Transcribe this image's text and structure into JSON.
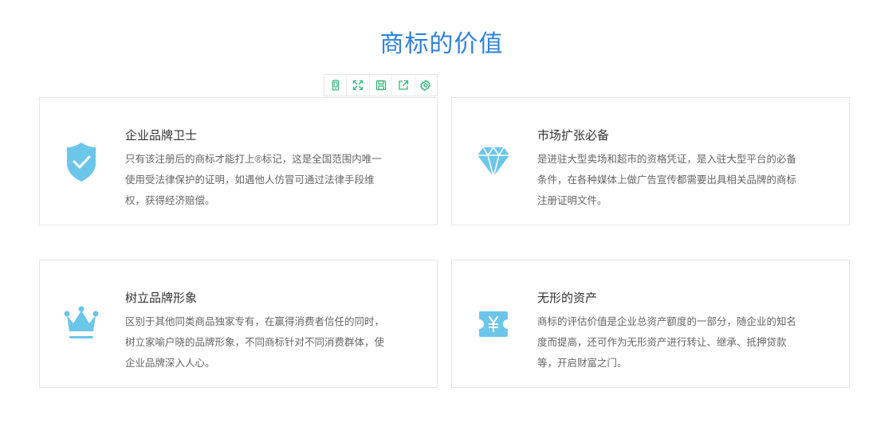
{
  "section": {
    "title": "商标的价值"
  },
  "colors": {
    "title": "#2f82dc",
    "icon": "#6cc6ea",
    "toolbar_icon": "#35b87c"
  },
  "toolbar": [
    {
      "icon": "mobile-icon"
    },
    {
      "icon": "expand-icon"
    },
    {
      "icon": "save-icon"
    },
    {
      "icon": "share-icon"
    },
    {
      "icon": "gear-icon"
    }
  ],
  "cards": [
    {
      "icon": "shield-check-icon",
      "title": "企业品牌卫士",
      "description": "只有该注册后的商标才能打上®标记，这是全国范围内唯一使用受法律保护的证明，如遇他人仿冒可通过法律手段维权，获得经济赔偿。"
    },
    {
      "icon": "diamond-icon",
      "title": "市场扩张必备",
      "description": "是进驻大型卖场和超市的资格凭证，是入驻大型平台的必备条件，在各种媒体上做广告宣传都需要出具相关品牌的商标注册证明文件。"
    },
    {
      "icon": "crown-icon",
      "title": "树立品牌形象",
      "description": "区别于其他同类商品独家专有，在赢得消费者信任的同时，树立家喻户晓的品牌形象，不同商标针对不同消费群体，使企业品牌深入人心。"
    },
    {
      "icon": "yen-ticket-icon",
      "title": "无形的资产",
      "description": "商标的评估价值是企业总资产额度的一部分，随企业的知名度而提高，还可作为无形资产进行转让、继承、抵押贷款等，开启财富之门。"
    }
  ]
}
